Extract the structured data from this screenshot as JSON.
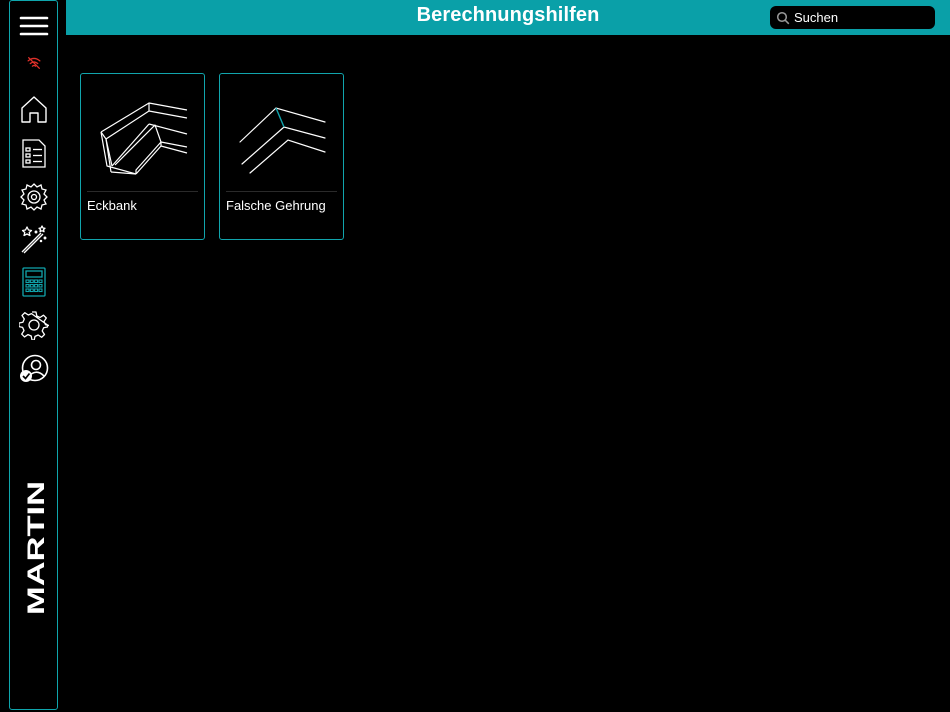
{
  "header": {
    "title": "Berechnungshilfen",
    "accent_color": "#0aa0a8"
  },
  "search": {
    "placeholder": "Suchen",
    "value": ""
  },
  "sidebar": {
    "items": [
      {
        "icon": "menu-icon",
        "label": "Menü"
      },
      {
        "icon": "wifi-off-icon",
        "label": "Offline",
        "color": "#e0302a"
      },
      {
        "icon": "home-icon",
        "label": "Start"
      },
      {
        "icon": "list-icon",
        "label": "Liste"
      },
      {
        "icon": "saw-blade-icon",
        "label": "Werkzeuge"
      },
      {
        "icon": "magic-wand-icon",
        "label": "Assistent"
      },
      {
        "icon": "calculator-icon",
        "label": "Berechnungshilfen",
        "selected": true
      },
      {
        "icon": "settings-gear-icon",
        "label": "Einstellungen"
      },
      {
        "icon": "user-account-icon",
        "label": "Konto"
      }
    ],
    "brand": "MARTIN"
  },
  "cards": [
    {
      "label": "Eckbank",
      "icon": "corner-bench-icon"
    },
    {
      "label": "Falsche Gehrung",
      "icon": "false-miter-icon"
    }
  ]
}
